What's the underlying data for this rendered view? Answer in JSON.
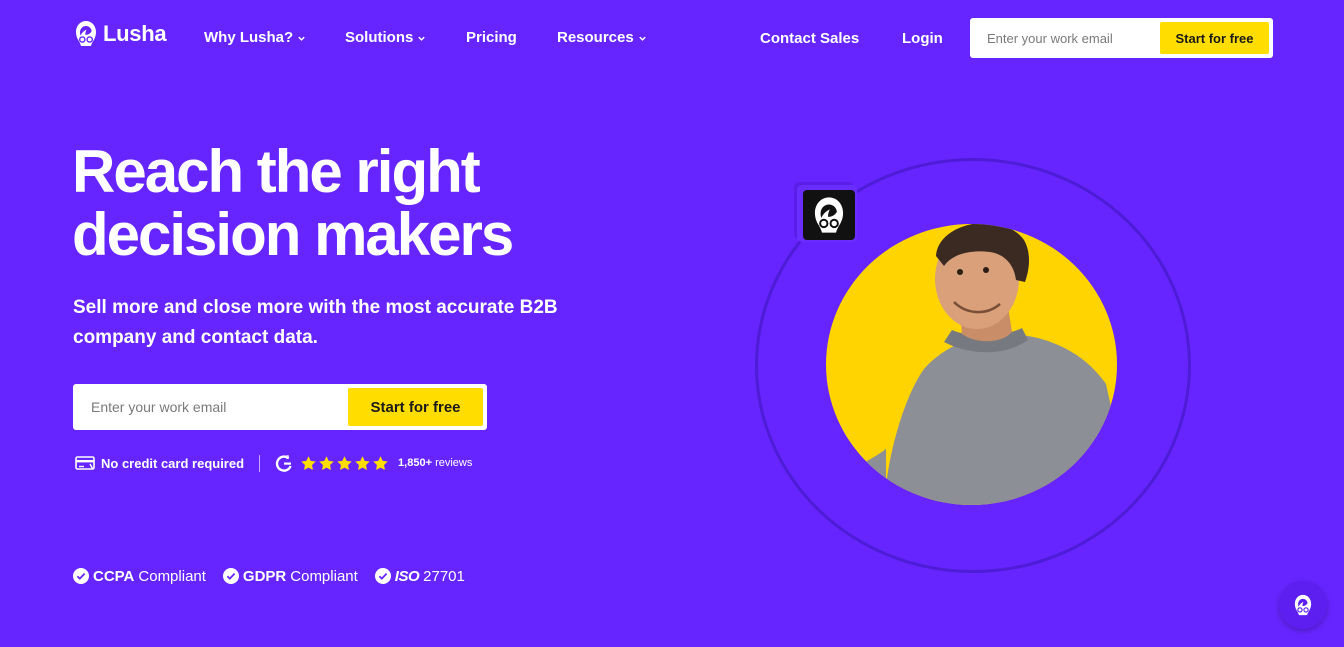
{
  "brand": {
    "name": "Lusha"
  },
  "nav": {
    "items": [
      {
        "label": "Why Lusha?",
        "dropdown": true
      },
      {
        "label": "Solutions",
        "dropdown": true
      },
      {
        "label": "Pricing",
        "dropdown": false
      },
      {
        "label": "Resources",
        "dropdown": true
      }
    ],
    "contact_sales": "Contact Sales",
    "login": "Login",
    "email_placeholder": "Enter your work email",
    "cta": "Start for free"
  },
  "hero": {
    "title_lines": [
      "Reach the right",
      "decision makers"
    ],
    "subtitle_lines": [
      "Sell more and close more with the most accurate B2B",
      "company and contact data."
    ],
    "email_placeholder": "Enter your work email",
    "cta": "Start for free",
    "no_credit_card": "No credit card required",
    "rating_stars": 5,
    "reviews_count": "1,850+",
    "reviews_label": "reviews"
  },
  "compliance": [
    {
      "strong": "CCPA",
      "light": "Compliant"
    },
    {
      "strong": "GDPR",
      "light": "Compliant"
    },
    {
      "strong": "ISO",
      "light": "27701"
    }
  ],
  "colors": {
    "background": "#6625ff",
    "accent_yellow": "#ffdd00",
    "ring": "#4e1cd6",
    "text": "#ffffff"
  },
  "icons": [
    "lusha-logo-icon",
    "chevron-down-icon",
    "credit-card-icon",
    "g2-icon",
    "star-icon",
    "check-circle-icon",
    "lusha-badge-icon",
    "chat-launcher-icon"
  ]
}
